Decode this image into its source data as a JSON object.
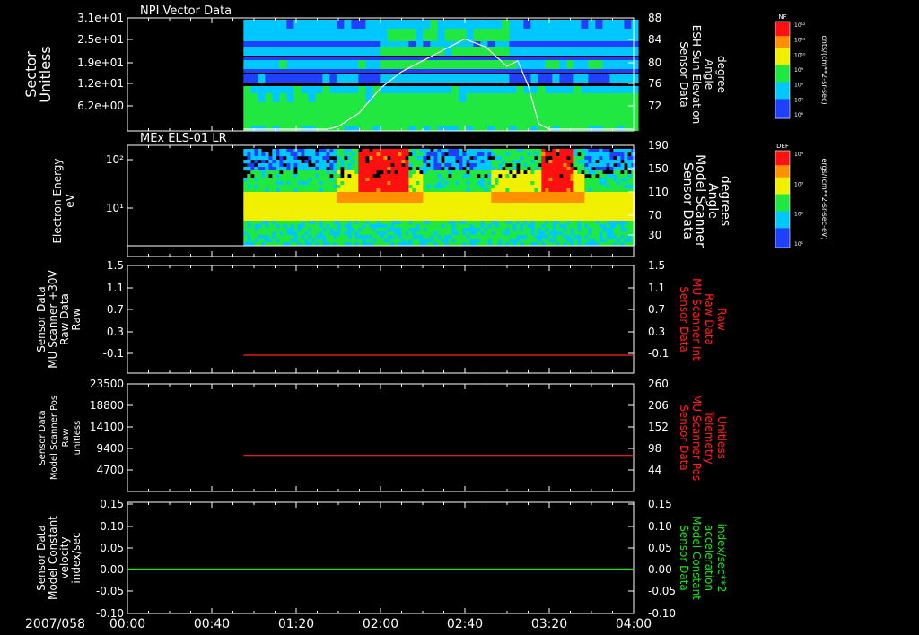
{
  "colors": {
    "background": "#000000",
    "axis": "#ffffff",
    "red_trace": "#ff2020",
    "green_trace": "#20e020",
    "elevation_line": "#ffffff"
  },
  "time_axis": {
    "date": "2007/058",
    "ticks": [
      "00:00",
      "00:40",
      "01:20",
      "02:00",
      "02:40",
      "03:20",
      "04:00"
    ],
    "range_min": [
      0,
      240
    ],
    "data_start_min": 55
  },
  "chart_data": [
    {
      "type": "heatmap",
      "title": "NPI Vector Data",
      "ylabel": [
        "Sector",
        "Unitless"
      ],
      "yticks": [
        "3.1e+01",
        "2.5e+01",
        "1.9e+01",
        "1.2e+01",
        "6.2e+00"
      ],
      "right_ylabel": [
        "Sensor Data",
        "ESH Sun Elevation",
        "Angle",
        "degree"
      ],
      "right_yticks": [
        "88",
        "84",
        "80",
        "76",
        "72"
      ],
      "right_ylim": [
        68,
        88
      ],
      "overlay_line": {
        "name": "ESH Sun Elevation Angle",
        "x_min": [
          55,
          95,
          100,
          110,
          120,
          130,
          140,
          150,
          160,
          170,
          175,
          180,
          185,
          190,
          195,
          200,
          240
        ],
        "y": [
          68,
          68,
          68.5,
          71,
          75.5,
          78.5,
          80.5,
          82.5,
          84.5,
          83,
          81.2,
          79.5,
          80.5,
          76,
          69,
          68,
          68
        ]
      },
      "colorbar": {
        "label": "NF",
        "units": "cnts/(cm**2-sr-sec)",
        "ticks": [
          "10¹²",
          "10¹¹",
          "10¹⁰",
          "10⁹",
          "10⁸",
          "10⁷",
          "10⁶"
        ]
      }
    },
    {
      "type": "heatmap",
      "title": "MEx ELS-01 LR",
      "ylabel": [
        "Electron Energy",
        "eV"
      ],
      "yticks": [
        "10²",
        "10¹"
      ],
      "right_ylabel": [
        "Sensor Data",
        "Model Scanner",
        "Angle",
        "degrees"
      ],
      "right_yticks": [
        "190",
        "150",
        "110",
        "70",
        "30"
      ],
      "colorbar": {
        "label": "DEF",
        "units": "ergs/(cm**2-sr-sec-eV)",
        "ticks": [
          "10⁴",
          "10³",
          "10²",
          "10¹"
        ]
      }
    },
    {
      "type": "line",
      "ylabel": [
        "Sensor Data",
        "MU Scanner +30V",
        "Raw Data",
        "Raw"
      ],
      "yticks": [
        "1.5",
        "1.1",
        "0.7",
        "0.3",
        "-0.1"
      ],
      "ylim": [
        -0.3,
        1.5
      ],
      "right_ylabel": [
        "Sensor Data",
        "MU Scanner Int",
        "Raw Data",
        "Raw"
      ],
      "right_yticks": [
        "1.5",
        "1.1",
        "0.7",
        "0.3",
        "-0.1"
      ],
      "series": [
        {
          "color": "red",
          "x_min": [
            55,
            240
          ],
          "values": [
            0,
            0
          ]
        }
      ]
    },
    {
      "type": "line",
      "ylabel": [
        "Sensor Data",
        "Model Scanner Pos",
        "Raw",
        "unitless"
      ],
      "yticks": [
        "23500",
        "18800",
        "14100",
        "9400",
        "4700"
      ],
      "ylim": [
        0,
        23500
      ],
      "right_ylabel": [
        "Sensor Data",
        "MU Scanner Pos",
        "Telemetry",
        "Unitless"
      ],
      "right_yticks": [
        "260",
        "206",
        "152",
        "98",
        "44"
      ],
      "series": [
        {
          "color": "red",
          "x_min": [
            55,
            240
          ],
          "values": [
            7900,
            7900
          ]
        }
      ]
    },
    {
      "type": "line",
      "ylabel": [
        "Sensor Data",
        "Model Constant",
        "velocity",
        "index/sec"
      ],
      "yticks": [
        "0.15",
        "0.10",
        "0.05",
        "0.00",
        "-0.05",
        "-0.10"
      ],
      "ylim": [
        -0.1,
        0.15
      ],
      "right_ylabel": [
        "Sensor Data",
        "Model Constant",
        "acceleration",
        "index/sec**2"
      ],
      "right_yticks": [
        "0.15",
        "0.10",
        "0.05",
        "0.00",
        "-0.05",
        "-0.10"
      ],
      "series": [
        {
          "color": "green",
          "x_min": [
            0,
            240
          ],
          "values": [
            0,
            0
          ]
        }
      ]
    }
  ]
}
